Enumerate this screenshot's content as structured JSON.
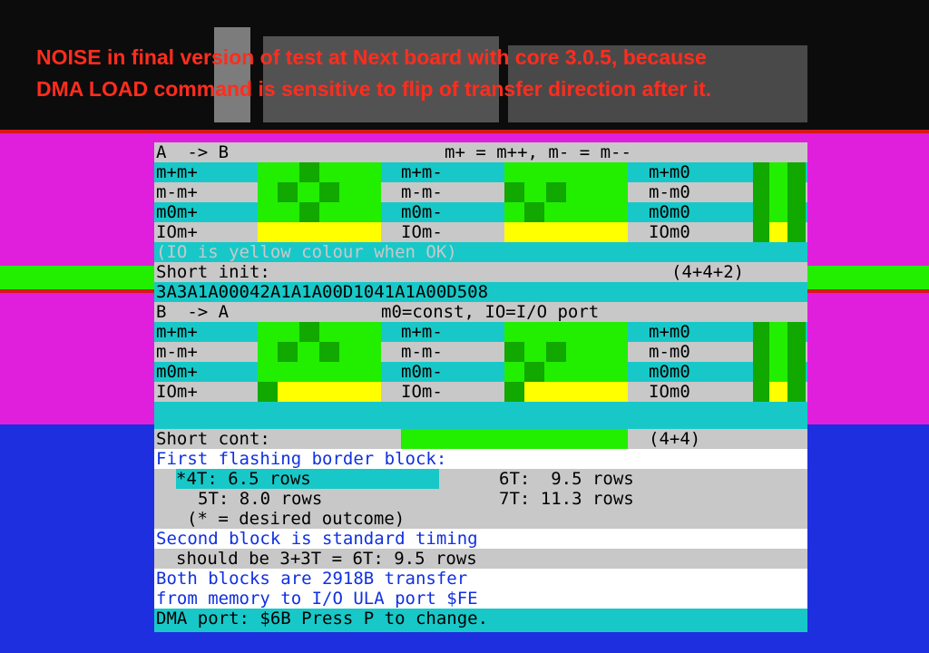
{
  "caption": {
    "line1": "NOISE in final version of test at Next board with core 3.0.5, because",
    "line2": "DMA LOAD command is sensitive to flip of transfer direction after it."
  },
  "colors": {
    "border_magenta": "#e01fdc",
    "border_blue": "#1e2fe0",
    "paper_grey": "#c8c8c8",
    "cyan": "#18c8c8",
    "green": "#22ee00",
    "dark_green": "#11a800",
    "yellow": "#ffff00",
    "ink_blue": "#1030e0",
    "caption_red": "#ff2d1e"
  },
  "section_a": {
    "header_left": "A  -> B",
    "header_right": "m+ = m++, m- = m--",
    "rows": [
      [
        "m+m+",
        "m+m-",
        "m+m0"
      ],
      [
        "m-m+",
        "m-m-",
        "m-m0"
      ],
      [
        "m0m+",
        "m0m-",
        "m0m0"
      ],
      [
        "IOm+",
        "IOm-",
        "IOm0"
      ]
    ],
    "io_note": "(IO is yellow colour when OK)"
  },
  "short_init": {
    "label": "Short init:",
    "value": "(4+4+2)",
    "hex": "3A3A1A00042A1A1A00D1041A1A00D508"
  },
  "section_b": {
    "header_left": "B  -> A",
    "header_right": "m0=const, IO=I/O port",
    "rows": [
      [
        "m+m+",
        "m+m-",
        "m+m0"
      ],
      [
        "m-m+",
        "m-m-",
        "m-m0"
      ],
      [
        "m0m+",
        "m0m-",
        "m0m0"
      ],
      [
        "IOm+",
        "IOm-",
        "IOm0"
      ]
    ]
  },
  "short_cont": {
    "label": "Short cont:",
    "value": "(4+4)"
  },
  "info": {
    "first_block": "First flashing border block:",
    "t4": "*4T: 6.5 rows",
    "t6": "6T:  9.5 rows",
    "t5": "5T: 8.0 rows",
    "t7": "7T: 11.3 rows",
    "desired": "(* = desired outcome)",
    "second_block": "Second block is standard timing",
    "should_be": "should be 3+3T = 6T: 9.5 rows",
    "both_blocks": "Both blocks are 2918B transfer",
    "from_memory": "from memory to I/O ULA port $FE",
    "dma_port": "DMA port: $6B Press P to change."
  }
}
